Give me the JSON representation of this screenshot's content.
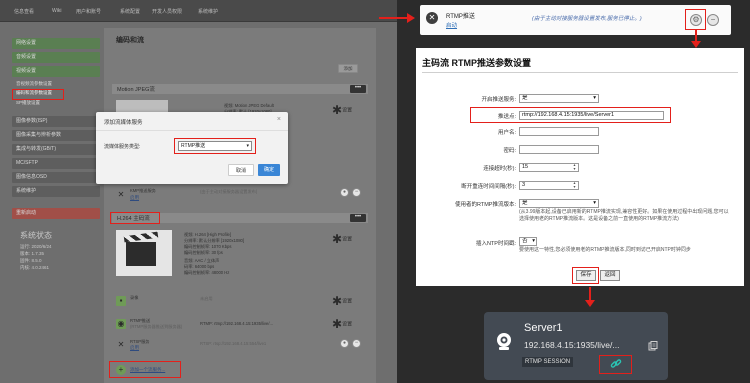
{
  "left": {
    "nav_tabs": [
      "信息查看",
      "Wiki",
      "用户和账号",
      "系统配置",
      "开发人员权限",
      "系统维护"
    ],
    "sidebar": {
      "items": [
        {
          "label": "网络设置",
          "tone": "green"
        },
        {
          "label": "音频设置",
          "tone": "green"
        },
        {
          "label": "视频设置",
          "tone": "green"
        },
        {
          "label": "图像参数(ISP)",
          "tone": "gray"
        },
        {
          "label": "图像采集与辨析参数",
          "tone": "gray"
        },
        {
          "label": "集成与转发(GB/T)",
          "tone": "gray"
        },
        {
          "label": "MC/SFTP",
          "tone": "gray"
        },
        {
          "label": "图像信息OSD",
          "tone": "gray"
        },
        {
          "label": "系统维护",
          "tone": "gray"
        },
        {
          "label": "重新启动",
          "tone": "red"
        }
      ],
      "subitems": [
        "音视频流参数设置",
        "编码和流参数设置",
        "SP播放设置"
      ],
      "sysinfo_title": "系统状态",
      "sysinfo_lines": [
        "运行: 2020/6/24",
        "版本: 1.7.35",
        "固件: 8.5.0",
        "内核: 4.0.2461"
      ]
    },
    "main": {
      "title": "编码和流",
      "sec1_label": "Motion JPEG流",
      "sec2_label": "H.264 主码流",
      "btn_small": "添加",
      "gear_label": "设置",
      "mjpeg_lines": [
        "视频: Motion JPEG Default",
        "分辨率: 默认 [1920x1080]",
        "帧率: 30.00"
      ],
      "h264_lines": [
        "视频: H.264 [High Profile]",
        "分辨率: 默认分辨率 [1920x1080]",
        "编码控制帧率: 1070 Kbps",
        "编码控制帧率: 30 fps",
        "音频: AAC / 立体声",
        "码率: 64000 bps",
        "编码控制帧率: 48000 Hz"
      ],
      "kmp_label": "KMP推送服务",
      "kmp_link": "启用",
      "kmp_note": "(由于主动对接服务器设置发布)",
      "rtmp_label": "RTMP推送",
      "rtmp_sub": "(RTMP服务器推送到服务器)",
      "rtmp_url": "RTMP: rtmp://192.168.4.15:1935/live/...",
      "rtsp_label": "RTSP服务",
      "rtsp_link": "启用",
      "rtsp_url": "RTSP: rtsp://192.168.4.15:554/live1",
      "recorder_label": "录像",
      "recorder_value": "未启用",
      "add_service": "添加一个流服务...",
      "bottom_link": "启用",
      "bottom_note": "(由于主动对接服务器设置发布)"
    },
    "dialog": {
      "title": "添加流媒体服务",
      "close": "×",
      "label": "流媒体服务类型:",
      "selected": "RTMP推送",
      "cancel": "取消",
      "ok": "确定"
    }
  },
  "notification": {
    "title": "RTMP推送",
    "link": "启动",
    "note": "(由于主动对接服务器设置发布,服务已停止。)"
  },
  "settings": {
    "title": "主码流 RTMP推送参数设置",
    "rows": [
      {
        "label": "开启推送服务:",
        "value": "是"
      },
      {
        "label": "推送点:",
        "value": "rtmp://192.168.4.15:1935/live/Server1"
      },
      {
        "label": "用户名:",
        "value": ""
      },
      {
        "label": "密码:",
        "value": ""
      },
      {
        "label": "连接超时(秒):",
        "value": "15"
      },
      {
        "label": "断开重连时间间隔(秒):",
        "value": "3"
      },
      {
        "label": "使用者的RTMP推流版本:",
        "value": "是"
      },
      {
        "label": "插入NTP时间戳:",
        "value": "否"
      }
    ],
    "version_note": "(从3.99版本起,设备已启用新的RTMP推流实现,兼容性更好。如果在使用过程中出现问题,您可以选择使用老的RTMP推流版本。这是设备之前一直使用的RTMP推流方法)",
    "ntp_note": "要使用这一特性,您必须使用老的RTMP推流版本,同时到访已开启NTP时钟同步",
    "save": "保存",
    "back": "返回"
  },
  "card": {
    "name": "Server1",
    "url": "192.168.4.15:1935/live/...",
    "badge": "RTMP SESSION"
  },
  "colors": {
    "highlight_red": "#e3201b",
    "confirm_blue": "#3a86d6",
    "card_bg": "#434a53",
    "link_color": "#2f6fb6",
    "link_icon": "#2ac3b2"
  }
}
